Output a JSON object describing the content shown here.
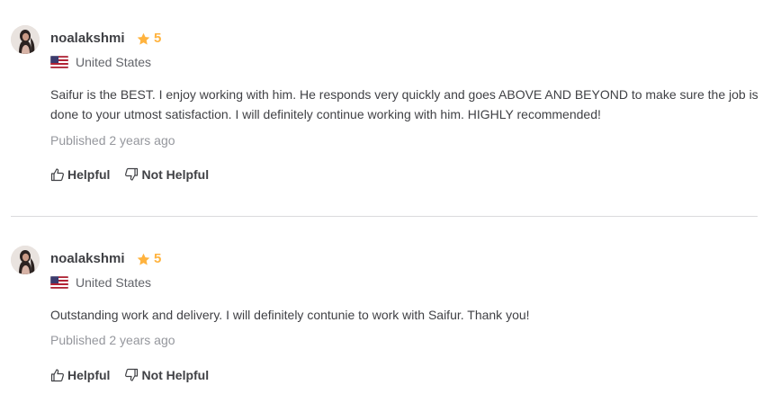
{
  "reviews": [
    {
      "username": "noalakshmi",
      "rating": "5",
      "country": "United States",
      "text": "Saifur is the BEST. I enjoy working with him. He responds very quickly and goes ABOVE AND BEYOND to make sure the job is done to your utmost satisfaction. I will definitely continue working with him. HIGHLY recommended!",
      "published": "Published 2 years ago",
      "helpful_label": "Helpful",
      "not_helpful_label": "Not Helpful"
    },
    {
      "username": "noalakshmi",
      "rating": "5",
      "country": "United States",
      "text": "Outstanding work and delivery. I will definitely contunie to work with Saifur. Thank you!",
      "published": "Published 2 years ago",
      "helpful_label": "Helpful",
      "not_helpful_label": "Not Helpful"
    }
  ],
  "icons": {
    "star": "star-icon",
    "flag": "us-flag-icon",
    "helpful": "thumbs-up-icon",
    "not_helpful": "thumbs-down-icon"
  },
  "colors": {
    "star": "#ffb33e",
    "text": "#404145",
    "muted": "#95979d",
    "divider": "#dadbdd"
  }
}
